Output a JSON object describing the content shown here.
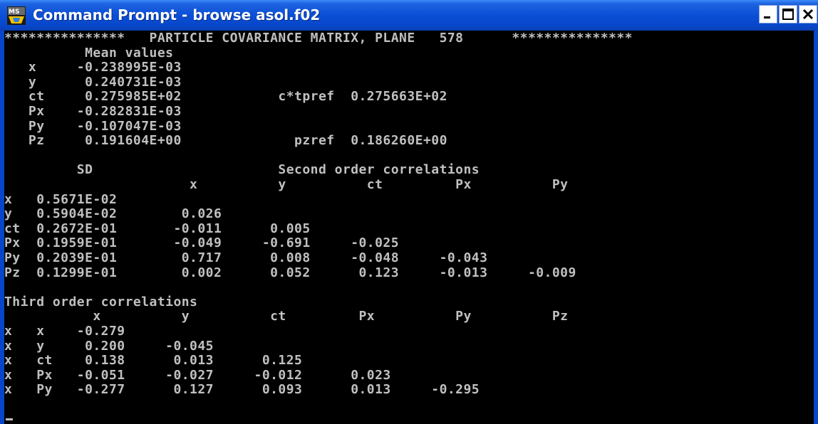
{
  "window": {
    "title": "Command Prompt - browse asol.f02",
    "icon": "ms-dos-icon",
    "controls": [
      "minimize",
      "maximize",
      "close"
    ]
  },
  "colors": {
    "titlebar": "#0a4fd6",
    "console_bg": "#000000",
    "console_text": "#c0c0c0"
  },
  "console": {
    "lines": [
      "***************   PARTICLE COVARIANCE MATRIX, PLANE   578      ***************",
      "          Mean values",
      "   x     -0.238995E-03",
      "   y      0.240731E-03",
      "   ct     0.275985E+02            c*tpref  0.275663E+02",
      "   Px    -0.282831E-03",
      "   Py    -0.107047E-03",
      "   Pz     0.191604E+00              pzref  0.186260E+00",
      "",
      "         SD                       Second order correlations",
      "                       x          y          ct         Px          Py",
      "x   0.5671E-02",
      "y   0.5904E-02        0.026",
      "ct  0.2672E-01       -0.011      0.005",
      "Px  0.1959E-01       -0.049     -0.691     -0.025",
      "Py  0.2039E-01        0.717      0.008     -0.048     -0.043",
      "Pz  0.1299E-01        0.002      0.052      0.123     -0.013     -0.009",
      "",
      "Third order correlations",
      "           x          y          ct         Px          Py          Pz",
      "x   x    -0.279",
      "x   y     0.200     -0.045",
      "x   ct    0.138      0.013      0.125",
      "x   Px   -0.051     -0.027     -0.012      0.023",
      "x   Py   -0.277      0.127      0.093      0.013     -0.295"
    ]
  }
}
